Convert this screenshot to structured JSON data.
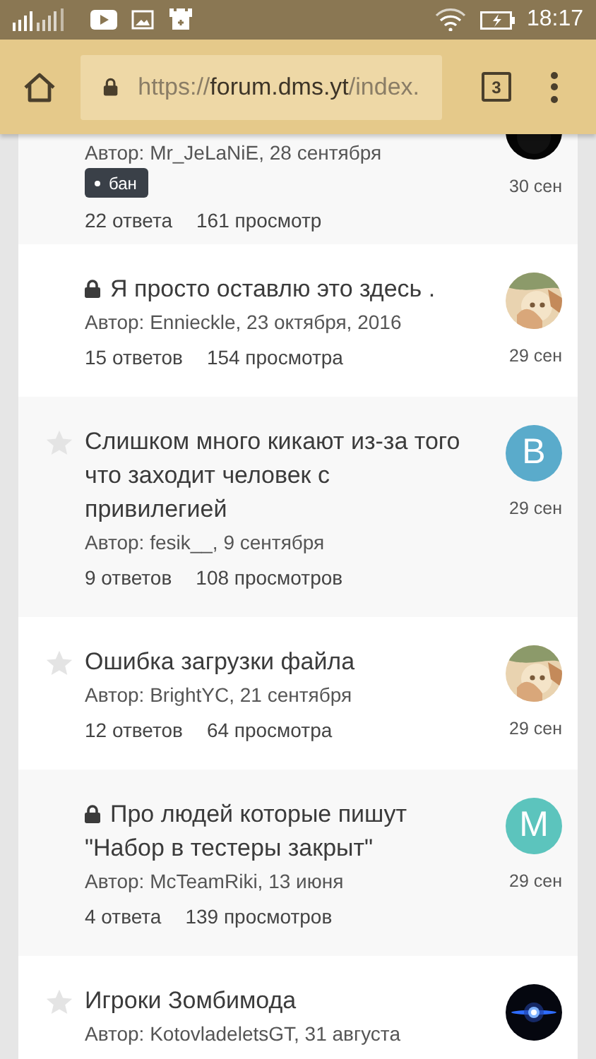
{
  "status_bar": {
    "time": "18:17"
  },
  "browser": {
    "url_scheme": "https://",
    "url_host": "forum.dms.yt",
    "url_path": "/index.",
    "tab_count": "3"
  },
  "topics": [
    {
      "author": "Автор: Mr_JeLaNiE, 28 сентября",
      "tags": [
        "бан"
      ],
      "replies": "22 ответа",
      "views": "161 просмотр",
      "date": "30 сен",
      "avatar": {
        "kind": "dark"
      }
    },
    {
      "locked": true,
      "title": "Я просто оставлю это здесь .",
      "author": "Автор: Ennieckle, 23 октября, 2016",
      "replies": "15 ответов",
      "views": "154 просмотра",
      "date": "29 сен"
    },
    {
      "locked": false,
      "title": "Слишком много кикают из-за того что заходит человек с привилегией",
      "author": "Автор: fesik__, 9 сентября",
      "replies": "9 ответов",
      "views": "108 просмотров",
      "date": "29 сен",
      "avatar": {
        "kind": "letter",
        "letter": "B",
        "color": "#5aabcb"
      }
    },
    {
      "locked": false,
      "title": "Ошибка загрузки файла",
      "author": "Автор: BrightYC, 21 сентября",
      "replies": "12 ответов",
      "views": "64 просмотра",
      "date": "29 сен"
    },
    {
      "locked": true,
      "title": "Про людей которые пишут \"Набор в тестеры закрыт\"",
      "author": "Автор: McTeamRiki, 13 июня",
      "replies": "4 ответа",
      "views": "139 просмотров",
      "date": "29 сен",
      "avatar": {
        "kind": "letter",
        "letter": "M",
        "color": "#5cc4bd"
      }
    },
    {
      "locked": false,
      "title": "Игроки Зомбимода",
      "author": "Автор: KotovladeletsGT, 31 августа",
      "avatar": {
        "kind": "space"
      }
    }
  ]
}
